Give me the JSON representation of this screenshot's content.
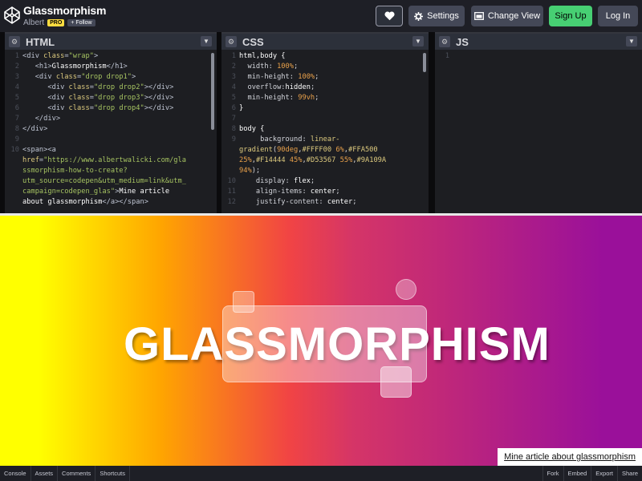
{
  "header": {
    "title": "Glassmorphism",
    "author": "Albert",
    "pro_badge": "PRO",
    "follow_label": "+ Follow",
    "settings_label": "Settings",
    "change_view_label": "Change View",
    "signup_label": "Sign Up",
    "login_label": "Log In"
  },
  "panes": {
    "html": {
      "title": "HTML"
    },
    "css": {
      "title": "CSS"
    },
    "js": {
      "title": "JS"
    }
  },
  "html_code": [
    {
      "n": "1",
      "parts": [
        [
          "t-tag",
          "<div "
        ],
        [
          "t-attr",
          "class"
        ],
        [
          "t-tag",
          "="
        ],
        [
          "t-val",
          "\"wrap\""
        ],
        [
          "t-tag",
          ">"
        ]
      ]
    },
    {
      "n": "2",
      "parts": [
        [
          "t-tag",
          "   <h1>"
        ],
        [
          "t-sel",
          "Glassmorphism"
        ],
        [
          "t-tag",
          "</h1>"
        ]
      ]
    },
    {
      "n": "3",
      "parts": [
        [
          "t-tag",
          "   <div "
        ],
        [
          "t-attr",
          "class"
        ],
        [
          "t-tag",
          "="
        ],
        [
          "t-val",
          "\"drop drop1\""
        ],
        [
          "t-tag",
          ">"
        ]
      ]
    },
    {
      "n": "4",
      "parts": [
        [
          "t-tag",
          "      <div "
        ],
        [
          "t-attr",
          "class"
        ],
        [
          "t-tag",
          "="
        ],
        [
          "t-val",
          "\"drop drop2\""
        ],
        [
          "t-tag",
          "></div>"
        ]
      ]
    },
    {
      "n": "5",
      "parts": [
        [
          "t-tag",
          "      <div "
        ],
        [
          "t-attr",
          "class"
        ],
        [
          "t-tag",
          "="
        ],
        [
          "t-val",
          "\"drop drop3\""
        ],
        [
          "t-tag",
          "></div>"
        ]
      ]
    },
    {
      "n": "6",
      "parts": [
        [
          "t-tag",
          "      <div "
        ],
        [
          "t-attr",
          "class"
        ],
        [
          "t-tag",
          "="
        ],
        [
          "t-val",
          "\"drop drop4\""
        ],
        [
          "t-tag",
          "></div>"
        ]
      ]
    },
    {
      "n": "7",
      "parts": [
        [
          "t-tag",
          "   </div>"
        ]
      ]
    },
    {
      "n": "8",
      "parts": [
        [
          "t-tag",
          "</div>"
        ]
      ]
    },
    {
      "n": "9",
      "parts": [
        [
          "t-tag",
          ""
        ]
      ]
    },
    {
      "n": "10",
      "parts": [
        [
          "t-tag",
          "<span><a"
        ]
      ]
    },
    {
      "n": "",
      "parts": [
        [
          "t-attr",
          "href"
        ],
        [
          "t-tag",
          "="
        ],
        [
          "t-val",
          "\"https://www.albertwalicki.com/gla"
        ]
      ]
    },
    {
      "n": "",
      "parts": [
        [
          "t-val",
          "ssmorphism-how-to-create?"
        ]
      ]
    },
    {
      "n": "",
      "parts": [
        [
          "t-val",
          "utm_source=codepen&utm_medium=link&utm_"
        ]
      ]
    },
    {
      "n": "",
      "parts": [
        [
          "t-val",
          "campaign=codepen_glas\""
        ],
        [
          "t-tag",
          ">"
        ],
        [
          "t-sel",
          "Mine article"
        ]
      ]
    },
    {
      "n": "",
      "parts": [
        [
          "t-sel",
          "about glassmorphism"
        ],
        [
          "t-tag",
          "</a></span>"
        ]
      ]
    }
  ],
  "css_code": [
    {
      "n": "1",
      "parts": [
        [
          "t-sel",
          "html,body {"
        ]
      ]
    },
    {
      "n": "2",
      "parts": [
        [
          "t-prop",
          "  width: "
        ],
        [
          "t-num",
          "100%"
        ],
        [
          "t-prop",
          ";"
        ]
      ]
    },
    {
      "n": "3",
      "parts": [
        [
          "t-prop",
          "  min-height: "
        ],
        [
          "t-num",
          "100%"
        ],
        [
          "t-prop",
          ";"
        ]
      ]
    },
    {
      "n": "4",
      "parts": [
        [
          "t-prop",
          "  overflow:"
        ],
        [
          "t-sel",
          "hidden"
        ],
        [
          "t-prop",
          ";"
        ]
      ]
    },
    {
      "n": "5",
      "parts": [
        [
          "t-prop",
          "  min-height: "
        ],
        [
          "t-num",
          "99vh"
        ],
        [
          "t-prop",
          ";"
        ]
      ]
    },
    {
      "n": "6",
      "parts": [
        [
          "t-sel",
          "}"
        ]
      ]
    },
    {
      "n": "7",
      "parts": [
        [
          "t-tag",
          ""
        ]
      ]
    },
    {
      "n": "8",
      "parts": [
        [
          "t-sel",
          "body {"
        ]
      ]
    },
    {
      "n": "9",
      "parts": [
        [
          "t-prop",
          "     background: "
        ],
        [
          "t-attr",
          "linear-"
        ]
      ]
    },
    {
      "n": "",
      "parts": [
        [
          "t-attr",
          "gradient"
        ],
        [
          "t-prop",
          "("
        ],
        [
          "t-num",
          "90deg"
        ],
        [
          "t-prop",
          ","
        ],
        [
          "t-attr",
          "#FFFF00"
        ],
        [
          "t-prop",
          " "
        ],
        [
          "t-num",
          "6%"
        ],
        [
          "t-prop",
          ","
        ],
        [
          "t-attr",
          "#FFA500"
        ]
      ]
    },
    {
      "n": "",
      "parts": [
        [
          "t-num",
          "25%"
        ],
        [
          "t-prop",
          ","
        ],
        [
          "t-attr",
          "#F14444"
        ],
        [
          "t-prop",
          " "
        ],
        [
          "t-num",
          "45%"
        ],
        [
          "t-prop",
          ","
        ],
        [
          "t-attr",
          "#D53567"
        ],
        [
          "t-prop",
          " "
        ],
        [
          "t-num",
          "55%"
        ],
        [
          "t-prop",
          ","
        ],
        [
          "t-attr",
          "#9A109A"
        ]
      ]
    },
    {
      "n": "",
      "parts": [
        [
          "t-num",
          "94%"
        ],
        [
          "t-prop",
          ");"
        ]
      ]
    },
    {
      "n": "10",
      "parts": [
        [
          "t-prop",
          "    display: "
        ],
        [
          "t-sel",
          "flex"
        ],
        [
          "t-prop",
          ";"
        ]
      ]
    },
    {
      "n": "11",
      "parts": [
        [
          "t-prop",
          "    align-items: "
        ],
        [
          "t-sel",
          "center"
        ],
        [
          "t-prop",
          ";"
        ]
      ]
    },
    {
      "n": "12",
      "parts": [
        [
          "t-prop",
          "    justify-content: "
        ],
        [
          "t-sel",
          "center"
        ],
        [
          "t-prop",
          ";"
        ]
      ]
    }
  ],
  "js_code": [
    {
      "n": "1",
      "parts": [
        [
          "t-tag",
          ""
        ]
      ]
    }
  ],
  "preview": {
    "heading": "GLASSMORPHISM",
    "article_link": "Mine article about glassmorphism"
  },
  "footer": {
    "left": [
      "Console",
      "Assets",
      "Comments",
      "Shortcuts"
    ],
    "right": [
      "Fork",
      "Embed",
      "Export",
      "Share"
    ]
  },
  "colors": {
    "signup": "#47cf73",
    "pro_badge": "#ffdd40",
    "header_bg": "#1e1f26"
  },
  "icons": [
    "codepen-logo-icon",
    "heart-icon",
    "gear-icon",
    "layout-icon",
    "chevron-down-icon"
  ]
}
